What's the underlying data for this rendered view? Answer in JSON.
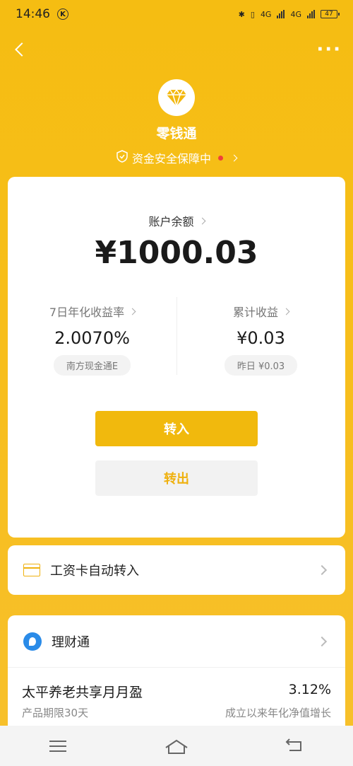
{
  "status_bar": {
    "time": "14:46",
    "k_badge": "K",
    "network1": "4G",
    "network2": "4G",
    "battery": "47"
  },
  "nav": {
    "more": "···"
  },
  "header": {
    "title": "零钱通",
    "safety_text": "资金安全保障中"
  },
  "balance": {
    "label": "账户余额",
    "value": "¥1000.03"
  },
  "stats": {
    "left": {
      "label": "7日年化收益率",
      "value": "2.0070%",
      "pill": "南方现金通E"
    },
    "right": {
      "label": "累计收益",
      "value": "¥0.03",
      "pill": "昨日 ¥0.03"
    }
  },
  "buttons": {
    "transfer_in": "转入",
    "transfer_out": "转出"
  },
  "auto_transfer": {
    "label": "工资卡自动转入"
  },
  "wealth": {
    "title": "理财通",
    "product": {
      "name": "太平养老共享月月盈",
      "rate": "3.12%",
      "term": "产品期限30天",
      "rate_desc": "成立以来年化净值增长"
    }
  },
  "colors": {
    "accent": "#f1b90d",
    "background": "#f5bd12"
  }
}
